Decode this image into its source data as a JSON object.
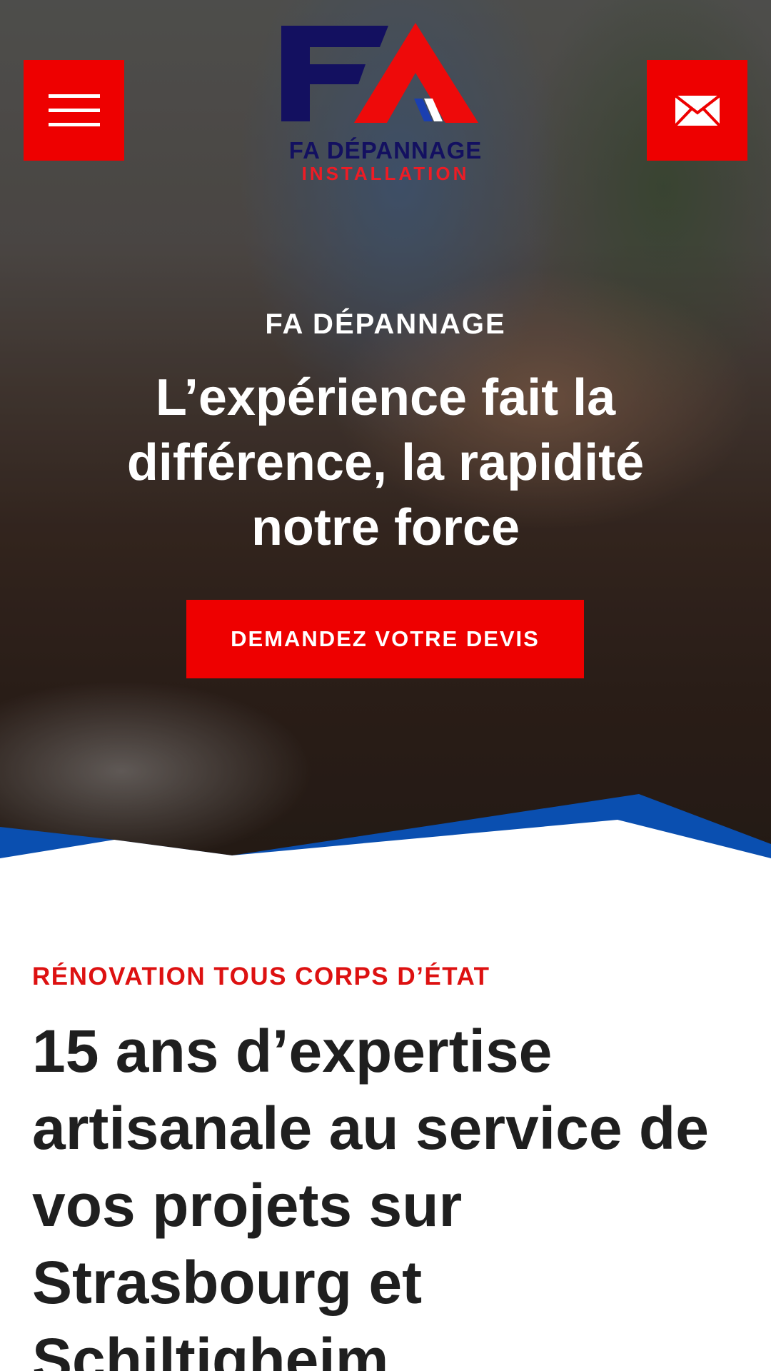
{
  "header": {
    "menu_icon": "hamburger-icon",
    "mail_icon": "envelope-icon",
    "logo": {
      "monogram": "FA",
      "line1": "FA DÉPANNAGE",
      "line2": "INSTALLATION"
    }
  },
  "hero": {
    "eyebrow": "FA DÉPANNAGE",
    "title": "L’expérience fait la différence, la rapidité notre force",
    "cta_label": "DEMANDEZ VOTRE DEVIS"
  },
  "section": {
    "eyebrow": "RÉNOVATION TOUS CORPS D’ÉTAT",
    "title": "15 ans d’expertise artisanale au service de vos projets sur Strasbourg et Schiltigheim"
  },
  "colors": {
    "accent_red": "#ee0000",
    "brand_navy": "#131060",
    "wave_blue": "#0a4fb0",
    "title_text": "#1f1f1f"
  }
}
